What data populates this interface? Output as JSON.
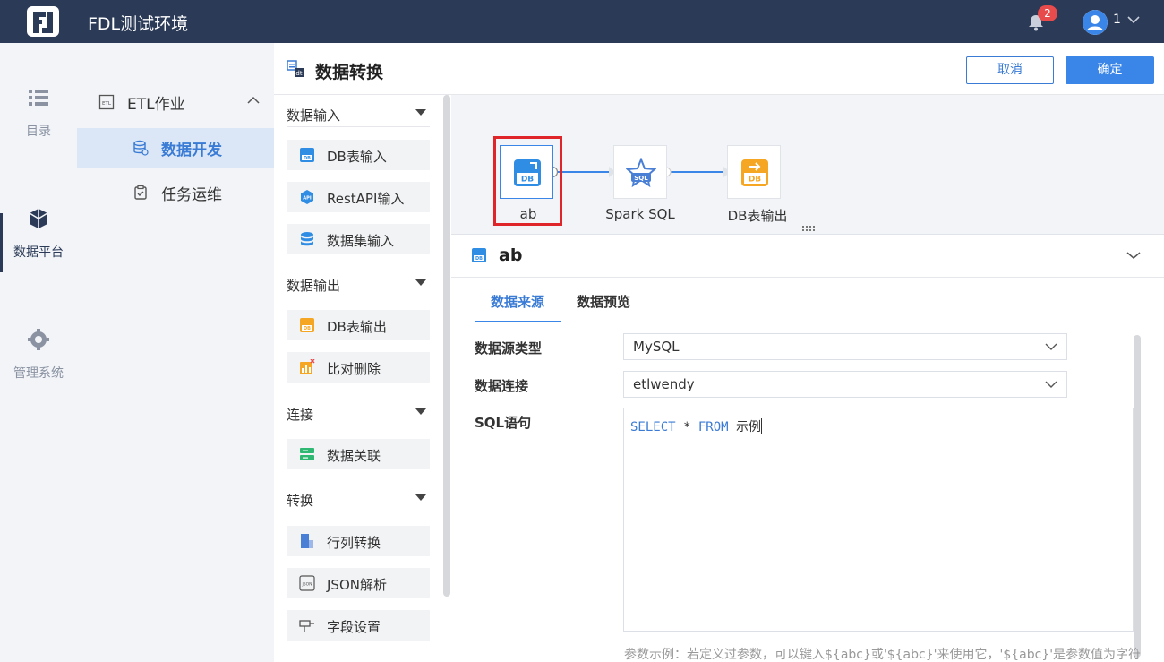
{
  "app": {
    "title": "FDL测试环境",
    "notification_count": "2",
    "user": "1"
  },
  "rail": {
    "items": [
      {
        "label": "目录",
        "icon": "list-icon"
      },
      {
        "label": "数据平台",
        "icon": "cube-icon"
      },
      {
        "label": "管理系统",
        "icon": "gear-icon"
      }
    ]
  },
  "tree": {
    "group_label": "ETL作业",
    "items": [
      {
        "label": "数据开发",
        "icon": "database-icon",
        "active": true
      },
      {
        "label": "任务运维",
        "icon": "clipboard-icon",
        "active": false
      }
    ]
  },
  "header": {
    "title": "数据转换",
    "cancel_label": "取消",
    "ok_label": "确定"
  },
  "palette": {
    "sections": [
      {
        "label": "数据输入",
        "items": [
          "DB表输入",
          "RestAPI输入",
          "数据集输入"
        ]
      },
      {
        "label": "数据输出",
        "items": [
          "DB表输出",
          "比对删除"
        ]
      },
      {
        "label": "连接",
        "items": [
          "数据关联"
        ]
      },
      {
        "label": "转换",
        "items": [
          "行列转换",
          "JSON解析",
          "字段设置"
        ]
      }
    ]
  },
  "canvas": {
    "nodes": [
      {
        "label": "ab",
        "icon": "db-input-icon",
        "selected": true
      },
      {
        "label": "Spark SQL",
        "icon": "spark-sql-icon"
      },
      {
        "label": "DB表输出",
        "icon": "db-output-icon"
      }
    ]
  },
  "props": {
    "title": "ab",
    "tabs": [
      "数据来源",
      "数据预览"
    ],
    "active_tab": "数据来源",
    "source_type_label": "数据源类型",
    "source_type_value": "MySQL",
    "connection_label": "数据连接",
    "connection_value": "etlwendy",
    "sql_label": "SQL语句",
    "sql": {
      "kw1": "SELECT",
      "mid": " * ",
      "kw2": "FROM",
      "rest": " 示例"
    },
    "hint": "参数示例：若定义过参数，可以键入${abc}或'${abc}'来使用它，'${abc}'是参数值为字符"
  },
  "colors": {
    "topbar": "#2b3a57",
    "accent": "#3a86e8",
    "highlight": "#e0252a"
  }
}
